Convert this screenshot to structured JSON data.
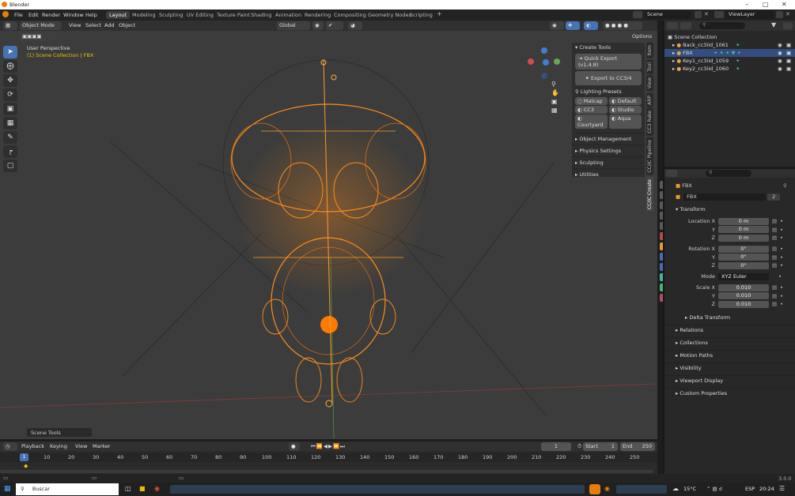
{
  "window": {
    "title": "Blender"
  },
  "menu": [
    "File",
    "Edit",
    "Render",
    "Window",
    "Help"
  ],
  "workspaces": [
    "Layout",
    "Modeling",
    "Sculpting",
    "UV Editing",
    "Texture Paint",
    "Shading",
    "Animation",
    "Rendering",
    "Compositing",
    "Geometry Nodes",
    "Scripting"
  ],
  "topright": {
    "scene": "Scene",
    "viewlayer": "ViewLayer"
  },
  "viewport_header": {
    "mode": "Object Mode",
    "menus": [
      "View",
      "Select",
      "Add",
      "Object"
    ],
    "transform": "Global",
    "options": "Options"
  },
  "viewport": {
    "perspective": "User Perspective",
    "collection": "(1) Scene Collection | FBX"
  },
  "npanel": {
    "create_tools": "Create Tools",
    "quick_export": "Quick Export  (v1.4.8)",
    "export_cc": "Export to CC3/4",
    "lighting_presets": "Lighting Presets",
    "presets": [
      "Matcap",
      "Default",
      "CC3",
      "Studio",
      "Courtyard",
      "Aqua"
    ],
    "sections": [
      "Object Management",
      "Physics Settings",
      "Sculpting",
      "Utilities"
    ]
  },
  "vtabs": [
    "Item",
    "Tool",
    "View",
    "ARP",
    "CC3 Rake",
    "CC/iC Pipeline",
    "CC/iC Create"
  ],
  "scene_tools": "Scene Tools",
  "outliner": {
    "root": "Scene Collection",
    "items": [
      "Back_cc3iid_1061",
      "FBX",
      "Key1_cc3iid_1059",
      "Key2_cc3iid_1060"
    ]
  },
  "properties": {
    "object_name": "FBX",
    "datablock": "FBX",
    "users": "2",
    "transform": "Transform",
    "location": {
      "label": "Location X",
      "x": "0 m",
      "y": "0 m",
      "z": "0 m"
    },
    "rotation": {
      "label": "Rotation X",
      "x": "0°",
      "y": "0°",
      "z": "0°"
    },
    "mode_label": "Mode",
    "mode": "XYZ Euler",
    "scale": {
      "label": "Scale X",
      "x": "0.010",
      "y": "0.010",
      "z": "0.010"
    },
    "axis": {
      "y": "Y",
      "z": "Z"
    },
    "delta": "Delta Transform",
    "sections": [
      "Relations",
      "Collections",
      "Motion Paths",
      "Visibility",
      "Viewport Display",
      "Custom Properties"
    ]
  },
  "timeline": {
    "menus": [
      "Playback",
      "Keying",
      "View",
      "Marker"
    ],
    "current_frame": "1",
    "start_label": "Start",
    "start": "1",
    "end_label": "End",
    "end": "250",
    "ticks": [
      "1",
      "10",
      "20",
      "30",
      "40",
      "50",
      "60",
      "70",
      "80",
      "90",
      "100",
      "110",
      "120",
      "130",
      "140",
      "150",
      "160",
      "170",
      "180",
      "190",
      "200",
      "210",
      "220",
      "230",
      "240",
      "250"
    ]
  },
  "status": {
    "version": "3.0.0"
  },
  "taskbar": {
    "search": "Buscar",
    "weather": "15°C",
    "language": "ESP",
    "time": "20:24"
  },
  "colors": {
    "accent": "#4772b3",
    "selection": "#ff8c1a",
    "active_tab": "#4a4a4a"
  }
}
